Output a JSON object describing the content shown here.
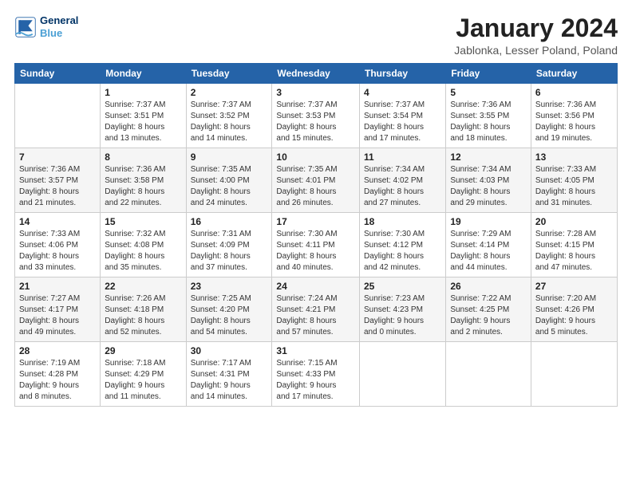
{
  "logo": {
    "line1": "General",
    "line2": "Blue"
  },
  "title": "January 2024",
  "location": "Jablonka, Lesser Poland, Poland",
  "days_header": [
    "Sunday",
    "Monday",
    "Tuesday",
    "Wednesday",
    "Thursday",
    "Friday",
    "Saturday"
  ],
  "weeks": [
    [
      {
        "day": "",
        "info": ""
      },
      {
        "day": "1",
        "info": "Sunrise: 7:37 AM\nSunset: 3:51 PM\nDaylight: 8 hours\nand 13 minutes."
      },
      {
        "day": "2",
        "info": "Sunrise: 7:37 AM\nSunset: 3:52 PM\nDaylight: 8 hours\nand 14 minutes."
      },
      {
        "day": "3",
        "info": "Sunrise: 7:37 AM\nSunset: 3:53 PM\nDaylight: 8 hours\nand 15 minutes."
      },
      {
        "day": "4",
        "info": "Sunrise: 7:37 AM\nSunset: 3:54 PM\nDaylight: 8 hours\nand 17 minutes."
      },
      {
        "day": "5",
        "info": "Sunrise: 7:36 AM\nSunset: 3:55 PM\nDaylight: 8 hours\nand 18 minutes."
      },
      {
        "day": "6",
        "info": "Sunrise: 7:36 AM\nSunset: 3:56 PM\nDaylight: 8 hours\nand 19 minutes."
      }
    ],
    [
      {
        "day": "7",
        "info": "Sunrise: 7:36 AM\nSunset: 3:57 PM\nDaylight: 8 hours\nand 21 minutes."
      },
      {
        "day": "8",
        "info": "Sunrise: 7:36 AM\nSunset: 3:58 PM\nDaylight: 8 hours\nand 22 minutes."
      },
      {
        "day": "9",
        "info": "Sunrise: 7:35 AM\nSunset: 4:00 PM\nDaylight: 8 hours\nand 24 minutes."
      },
      {
        "day": "10",
        "info": "Sunrise: 7:35 AM\nSunset: 4:01 PM\nDaylight: 8 hours\nand 26 minutes."
      },
      {
        "day": "11",
        "info": "Sunrise: 7:34 AM\nSunset: 4:02 PM\nDaylight: 8 hours\nand 27 minutes."
      },
      {
        "day": "12",
        "info": "Sunrise: 7:34 AM\nSunset: 4:03 PM\nDaylight: 8 hours\nand 29 minutes."
      },
      {
        "day": "13",
        "info": "Sunrise: 7:33 AM\nSunset: 4:05 PM\nDaylight: 8 hours\nand 31 minutes."
      }
    ],
    [
      {
        "day": "14",
        "info": "Sunrise: 7:33 AM\nSunset: 4:06 PM\nDaylight: 8 hours\nand 33 minutes."
      },
      {
        "day": "15",
        "info": "Sunrise: 7:32 AM\nSunset: 4:08 PM\nDaylight: 8 hours\nand 35 minutes."
      },
      {
        "day": "16",
        "info": "Sunrise: 7:31 AM\nSunset: 4:09 PM\nDaylight: 8 hours\nand 37 minutes."
      },
      {
        "day": "17",
        "info": "Sunrise: 7:30 AM\nSunset: 4:11 PM\nDaylight: 8 hours\nand 40 minutes."
      },
      {
        "day": "18",
        "info": "Sunrise: 7:30 AM\nSunset: 4:12 PM\nDaylight: 8 hours\nand 42 minutes."
      },
      {
        "day": "19",
        "info": "Sunrise: 7:29 AM\nSunset: 4:14 PM\nDaylight: 8 hours\nand 44 minutes."
      },
      {
        "day": "20",
        "info": "Sunrise: 7:28 AM\nSunset: 4:15 PM\nDaylight: 8 hours\nand 47 minutes."
      }
    ],
    [
      {
        "day": "21",
        "info": "Sunrise: 7:27 AM\nSunset: 4:17 PM\nDaylight: 8 hours\nand 49 minutes."
      },
      {
        "day": "22",
        "info": "Sunrise: 7:26 AM\nSunset: 4:18 PM\nDaylight: 8 hours\nand 52 minutes."
      },
      {
        "day": "23",
        "info": "Sunrise: 7:25 AM\nSunset: 4:20 PM\nDaylight: 8 hours\nand 54 minutes."
      },
      {
        "day": "24",
        "info": "Sunrise: 7:24 AM\nSunset: 4:21 PM\nDaylight: 8 hours\nand 57 minutes."
      },
      {
        "day": "25",
        "info": "Sunrise: 7:23 AM\nSunset: 4:23 PM\nDaylight: 9 hours\nand 0 minutes."
      },
      {
        "day": "26",
        "info": "Sunrise: 7:22 AM\nSunset: 4:25 PM\nDaylight: 9 hours\nand 2 minutes."
      },
      {
        "day": "27",
        "info": "Sunrise: 7:20 AM\nSunset: 4:26 PM\nDaylight: 9 hours\nand 5 minutes."
      }
    ],
    [
      {
        "day": "28",
        "info": "Sunrise: 7:19 AM\nSunset: 4:28 PM\nDaylight: 9 hours\nand 8 minutes."
      },
      {
        "day": "29",
        "info": "Sunrise: 7:18 AM\nSunset: 4:29 PM\nDaylight: 9 hours\nand 11 minutes."
      },
      {
        "day": "30",
        "info": "Sunrise: 7:17 AM\nSunset: 4:31 PM\nDaylight: 9 hours\nand 14 minutes."
      },
      {
        "day": "31",
        "info": "Sunrise: 7:15 AM\nSunset: 4:33 PM\nDaylight: 9 hours\nand 17 minutes."
      },
      {
        "day": "",
        "info": ""
      },
      {
        "day": "",
        "info": ""
      },
      {
        "day": "",
        "info": ""
      }
    ]
  ]
}
